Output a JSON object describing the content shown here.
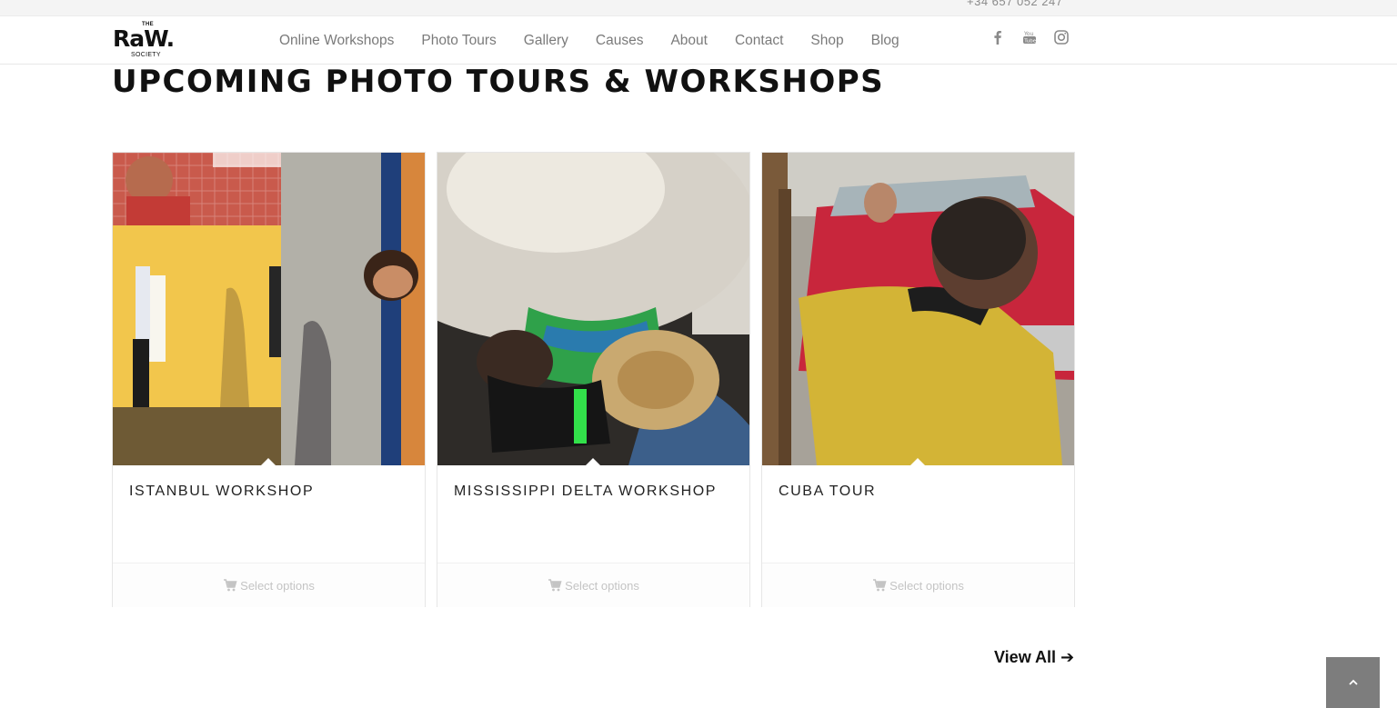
{
  "topbar": {
    "phone": "+34 657 052 247"
  },
  "header": {
    "logo": {
      "the": "THE",
      "name": "RaW.",
      "society": "SOCIETY"
    },
    "nav": [
      {
        "label": "Online Workshops"
      },
      {
        "label": "Photo Tours"
      },
      {
        "label": "Gallery"
      },
      {
        "label": "Causes"
      },
      {
        "label": "About"
      },
      {
        "label": "Contact"
      },
      {
        "label": "Shop"
      },
      {
        "label": "Blog"
      }
    ],
    "social": [
      "facebook-icon",
      "youtube-icon",
      "instagram-icon"
    ]
  },
  "main": {
    "title": "UPCOMING PHOTO TOURS & WORKSHOPS",
    "cards": [
      {
        "title": "ISTANBUL WORKSHOP",
        "button": "Select options"
      },
      {
        "title": "MISSISSIPPI DELTA WORKSHOP",
        "button": "Select options"
      },
      {
        "title": "CUBA TOUR",
        "button": "Select options"
      }
    ],
    "view_all": "View All ➔"
  },
  "colors": {
    "nav_text": "#7a7a7a",
    "heading": "#111111",
    "button_text": "#c4c4c4",
    "scroll_top_bg": "#7d7d7d"
  }
}
